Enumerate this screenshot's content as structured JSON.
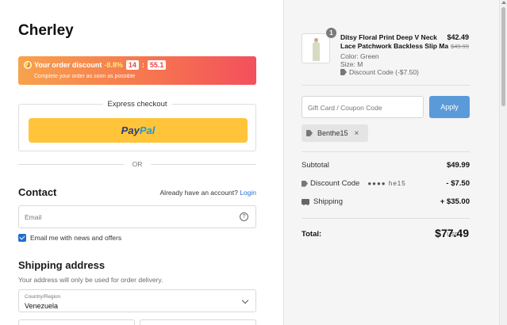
{
  "store": {
    "name": "Cherley"
  },
  "discount_banner": {
    "title": "Your order discount",
    "percent": "-8.8%",
    "timer_minutes": "14",
    "timer_sep": ":",
    "timer_seconds": "55.1",
    "subtitle": "Complete your order as soon as possible"
  },
  "express": {
    "title": "Express checkout",
    "paypal_part1": "Pay",
    "paypal_part2": "Pal"
  },
  "divider": {
    "or": "OR"
  },
  "contact": {
    "title": "Contact",
    "login_prompt": "Already have an account?",
    "login_link": "Login",
    "email_placeholder": "Email",
    "help": "?",
    "news_label": "Email me with news and offers",
    "news_checked": true
  },
  "shipping": {
    "title": "Shipping address",
    "note": "Your address will only be used for order delivery.",
    "country_label": "Country/Region",
    "country_value": "Venezuela"
  },
  "product": {
    "quantity": "1",
    "name_line1": "Ditsy Floral Print Deep V Neck",
    "name_line2": "Lace Patchwork Backless Slip Ma...",
    "color": "Color: Green",
    "size": "Size: M",
    "discount": "Discount Code (-$7.50)",
    "price": "$42.49",
    "original_price": "$49.99"
  },
  "coupon": {
    "placeholder": "Gift Card / Coupon Code",
    "apply_label": "Apply",
    "applied_code": "Benthe15",
    "remove": "×"
  },
  "summary": {
    "subtotal_label": "Subtotal",
    "subtotal": "$49.99",
    "discount_label": "Discount Code",
    "discount_code_masked": "●●●● he15",
    "discount": "- $7.50",
    "shipping_label": "Shipping",
    "shipping": "+ $35.00",
    "total_label": "Total:",
    "currency": "USD",
    "total": "$77.49"
  },
  "colors": {
    "accent_blue": "#5a9ad9",
    "paypal_yellow": "#ffc439",
    "banner_start": "#f7a24d",
    "banner_end": "#f3505d",
    "link": "#2a6fd6"
  }
}
